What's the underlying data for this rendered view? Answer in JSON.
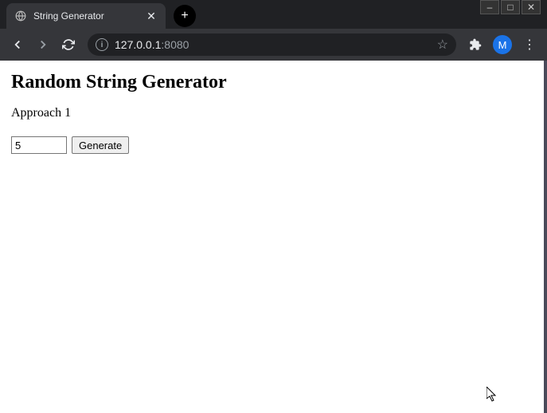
{
  "window": {
    "minimize": "–",
    "maximize": "□",
    "close": "✕"
  },
  "tab": {
    "title": "String Generator",
    "close": "✕"
  },
  "newTab": "+",
  "toolbar": {
    "info": "i",
    "url_host": "127.0.0.1",
    "url_port": ":8080",
    "star": "☆",
    "puzzle": "✦",
    "profile_initial": "M",
    "menu": "⋮"
  },
  "page": {
    "heading": "Random String Generator",
    "subheading": "Approach 1",
    "input_value": "5",
    "generate_label": "Generate"
  }
}
